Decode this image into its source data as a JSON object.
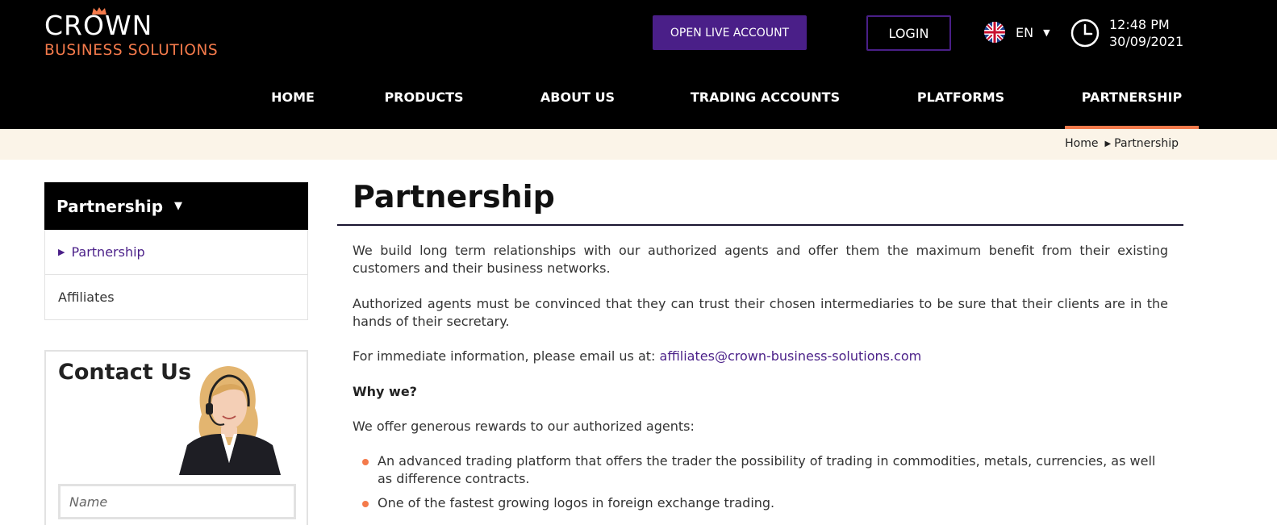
{
  "brand": {
    "name": "CROWN",
    "tagline": "BUSINESS SOLUTIONS",
    "accent_color": "#f47a4b",
    "primary_color": "#4a1f88"
  },
  "header": {
    "open_account_label": "OPEN LIVE ACCOUNT",
    "login_label": "LOGIN",
    "language": {
      "code": "EN",
      "flag_icon": "uk-flag-icon"
    },
    "clock": {
      "time": "12:48 PM",
      "date": "30/09/2021",
      "icon": "clock-icon"
    }
  },
  "nav": {
    "items": [
      {
        "label": "HOME"
      },
      {
        "label": "PRODUCTS"
      },
      {
        "label": "ABOUT US"
      },
      {
        "label": "TRADING ACCOUNTS"
      },
      {
        "label": "PLATFORMS"
      },
      {
        "label": "PARTNERSHIP",
        "active": true
      }
    ]
  },
  "breadcrumb": {
    "home": "Home",
    "current": "Partnership"
  },
  "sidebar": {
    "heading": "Partnership",
    "items": [
      {
        "label": "Partnership",
        "active": true
      },
      {
        "label": "Affiliates"
      }
    ]
  },
  "contact": {
    "title": "Contact Us",
    "name_placeholder": "Name"
  },
  "main": {
    "title": "Partnership",
    "para1": "We build long term relationships with our authorized agents and offer them the maximum benefit from their existing customers and their business networks.",
    "para2": "Authorized agents must be convinced that they can trust their chosen intermediaries to be sure that their clients are in the hands of their secretary.",
    "email_prefix": "For immediate information, please email us at: ",
    "email": "affiliates@crown-business-solutions.com",
    "why_heading": "Why we?",
    "rewards_intro": "We offer generous rewards to our authorized agents:",
    "bullets": [
      "An advanced trading platform that offers the trader the possibility of trading in commodities, metals, currencies, as well as difference contracts.",
      "One of the fastest growing logos in foreign exchange trading."
    ]
  }
}
